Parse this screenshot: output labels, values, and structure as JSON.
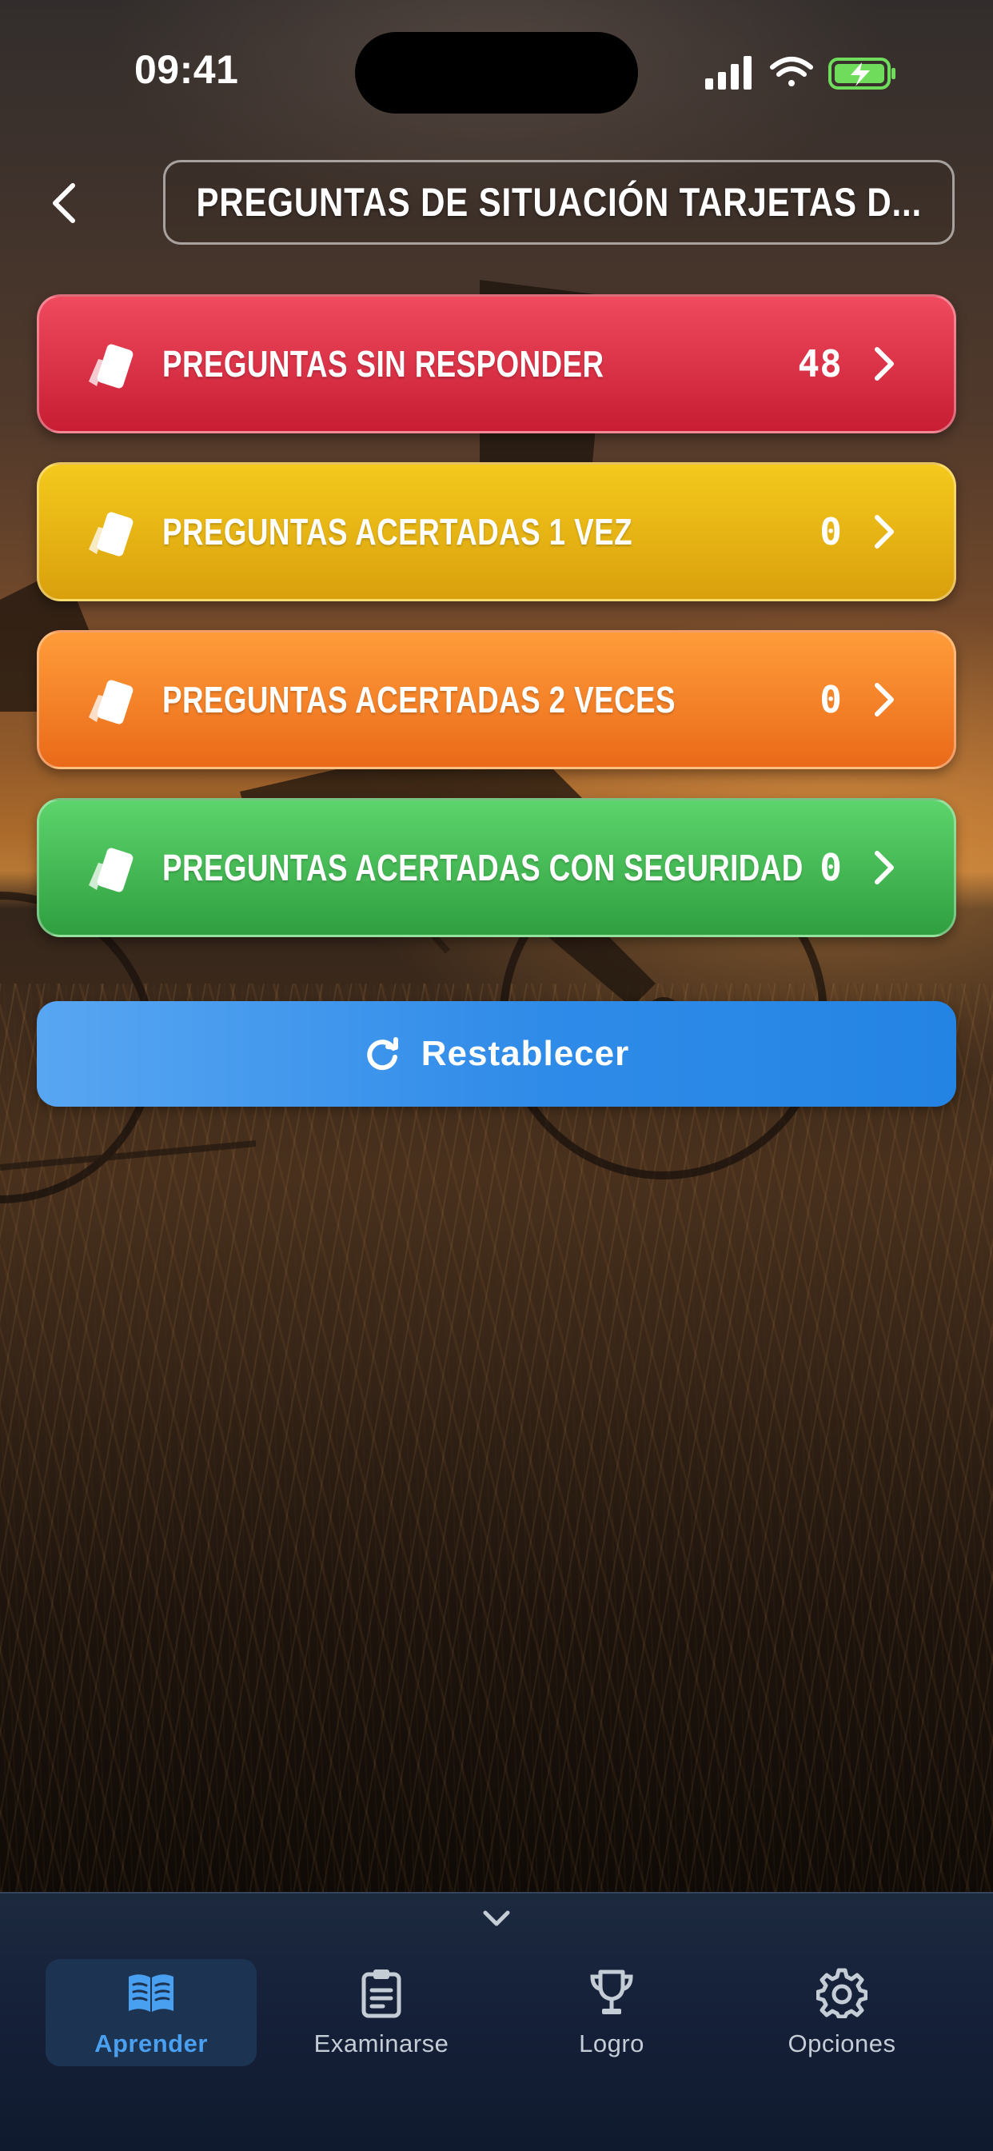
{
  "status_bar": {
    "time": "09:41"
  },
  "header": {
    "title": "PREGUNTAS DE SITUACIÓN TARJETAS D..."
  },
  "categories": [
    {
      "label": "PREGUNTAS SIN RESPONDER",
      "count": "48",
      "color": "#d92a41"
    },
    {
      "label": "PREGUNTAS ACERTADAS 1 VEZ",
      "count": "0",
      "color": "#e7b414"
    },
    {
      "label": "PREGUNTAS ACERTADAS 2 VECES",
      "count": "0",
      "color": "#f4832a"
    },
    {
      "label": "PREGUNTAS ACERTADAS CON SEGURIDAD",
      "count": "0",
      "color": "#44b854"
    }
  ],
  "reset": {
    "label": "Restablecer",
    "color": "#3a93ec"
  },
  "tabs": [
    {
      "label": "Aprender",
      "icon": "book-icon",
      "active": true
    },
    {
      "label": "Examinarse",
      "icon": "clipboard-icon",
      "active": false
    },
    {
      "label": "Logro",
      "icon": "trophy-icon",
      "active": false
    },
    {
      "label": "Opciones",
      "icon": "gear-icon",
      "active": false
    }
  ],
  "colors": {
    "active_tab": "#4aa0f0",
    "tabbar_bg": "#16213a"
  }
}
